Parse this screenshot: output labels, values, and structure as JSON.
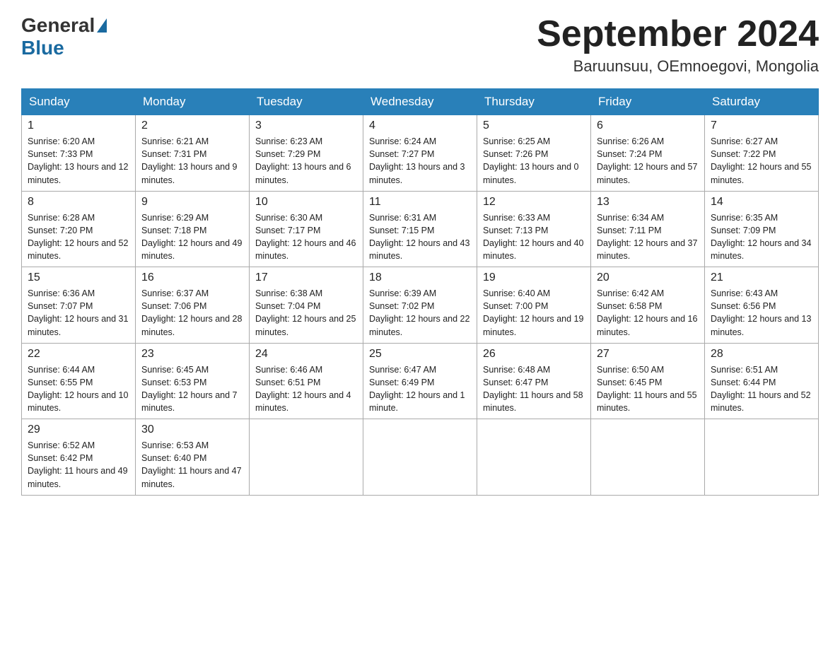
{
  "header": {
    "logo_general": "General",
    "logo_blue": "Blue",
    "month_title": "September 2024",
    "location": "Baruunsuu, OEmnoegovi, Mongolia"
  },
  "days_of_week": [
    "Sunday",
    "Monday",
    "Tuesday",
    "Wednesday",
    "Thursday",
    "Friday",
    "Saturday"
  ],
  "weeks": [
    [
      {
        "day": "1",
        "sunrise": "6:20 AM",
        "sunset": "7:33 PM",
        "daylight": "13 hours and 12 minutes."
      },
      {
        "day": "2",
        "sunrise": "6:21 AM",
        "sunset": "7:31 PM",
        "daylight": "13 hours and 9 minutes."
      },
      {
        "day": "3",
        "sunrise": "6:23 AM",
        "sunset": "7:29 PM",
        "daylight": "13 hours and 6 minutes."
      },
      {
        "day": "4",
        "sunrise": "6:24 AM",
        "sunset": "7:27 PM",
        "daylight": "13 hours and 3 minutes."
      },
      {
        "day": "5",
        "sunrise": "6:25 AM",
        "sunset": "7:26 PM",
        "daylight": "13 hours and 0 minutes."
      },
      {
        "day": "6",
        "sunrise": "6:26 AM",
        "sunset": "7:24 PM",
        "daylight": "12 hours and 57 minutes."
      },
      {
        "day": "7",
        "sunrise": "6:27 AM",
        "sunset": "7:22 PM",
        "daylight": "12 hours and 55 minutes."
      }
    ],
    [
      {
        "day": "8",
        "sunrise": "6:28 AM",
        "sunset": "7:20 PM",
        "daylight": "12 hours and 52 minutes."
      },
      {
        "day": "9",
        "sunrise": "6:29 AM",
        "sunset": "7:18 PM",
        "daylight": "12 hours and 49 minutes."
      },
      {
        "day": "10",
        "sunrise": "6:30 AM",
        "sunset": "7:17 PM",
        "daylight": "12 hours and 46 minutes."
      },
      {
        "day": "11",
        "sunrise": "6:31 AM",
        "sunset": "7:15 PM",
        "daylight": "12 hours and 43 minutes."
      },
      {
        "day": "12",
        "sunrise": "6:33 AM",
        "sunset": "7:13 PM",
        "daylight": "12 hours and 40 minutes."
      },
      {
        "day": "13",
        "sunrise": "6:34 AM",
        "sunset": "7:11 PM",
        "daylight": "12 hours and 37 minutes."
      },
      {
        "day": "14",
        "sunrise": "6:35 AM",
        "sunset": "7:09 PM",
        "daylight": "12 hours and 34 minutes."
      }
    ],
    [
      {
        "day": "15",
        "sunrise": "6:36 AM",
        "sunset": "7:07 PM",
        "daylight": "12 hours and 31 minutes."
      },
      {
        "day": "16",
        "sunrise": "6:37 AM",
        "sunset": "7:06 PM",
        "daylight": "12 hours and 28 minutes."
      },
      {
        "day": "17",
        "sunrise": "6:38 AM",
        "sunset": "7:04 PM",
        "daylight": "12 hours and 25 minutes."
      },
      {
        "day": "18",
        "sunrise": "6:39 AM",
        "sunset": "7:02 PM",
        "daylight": "12 hours and 22 minutes."
      },
      {
        "day": "19",
        "sunrise": "6:40 AM",
        "sunset": "7:00 PM",
        "daylight": "12 hours and 19 minutes."
      },
      {
        "day": "20",
        "sunrise": "6:42 AM",
        "sunset": "6:58 PM",
        "daylight": "12 hours and 16 minutes."
      },
      {
        "day": "21",
        "sunrise": "6:43 AM",
        "sunset": "6:56 PM",
        "daylight": "12 hours and 13 minutes."
      }
    ],
    [
      {
        "day": "22",
        "sunrise": "6:44 AM",
        "sunset": "6:55 PM",
        "daylight": "12 hours and 10 minutes."
      },
      {
        "day": "23",
        "sunrise": "6:45 AM",
        "sunset": "6:53 PM",
        "daylight": "12 hours and 7 minutes."
      },
      {
        "day": "24",
        "sunrise": "6:46 AM",
        "sunset": "6:51 PM",
        "daylight": "12 hours and 4 minutes."
      },
      {
        "day": "25",
        "sunrise": "6:47 AM",
        "sunset": "6:49 PM",
        "daylight": "12 hours and 1 minute."
      },
      {
        "day": "26",
        "sunrise": "6:48 AM",
        "sunset": "6:47 PM",
        "daylight": "11 hours and 58 minutes."
      },
      {
        "day": "27",
        "sunrise": "6:50 AM",
        "sunset": "6:45 PM",
        "daylight": "11 hours and 55 minutes."
      },
      {
        "day": "28",
        "sunrise": "6:51 AM",
        "sunset": "6:44 PM",
        "daylight": "11 hours and 52 minutes."
      }
    ],
    [
      {
        "day": "29",
        "sunrise": "6:52 AM",
        "sunset": "6:42 PM",
        "daylight": "11 hours and 49 minutes."
      },
      {
        "day": "30",
        "sunrise": "6:53 AM",
        "sunset": "6:40 PM",
        "daylight": "11 hours and 47 minutes."
      },
      null,
      null,
      null,
      null,
      null
    ]
  ]
}
